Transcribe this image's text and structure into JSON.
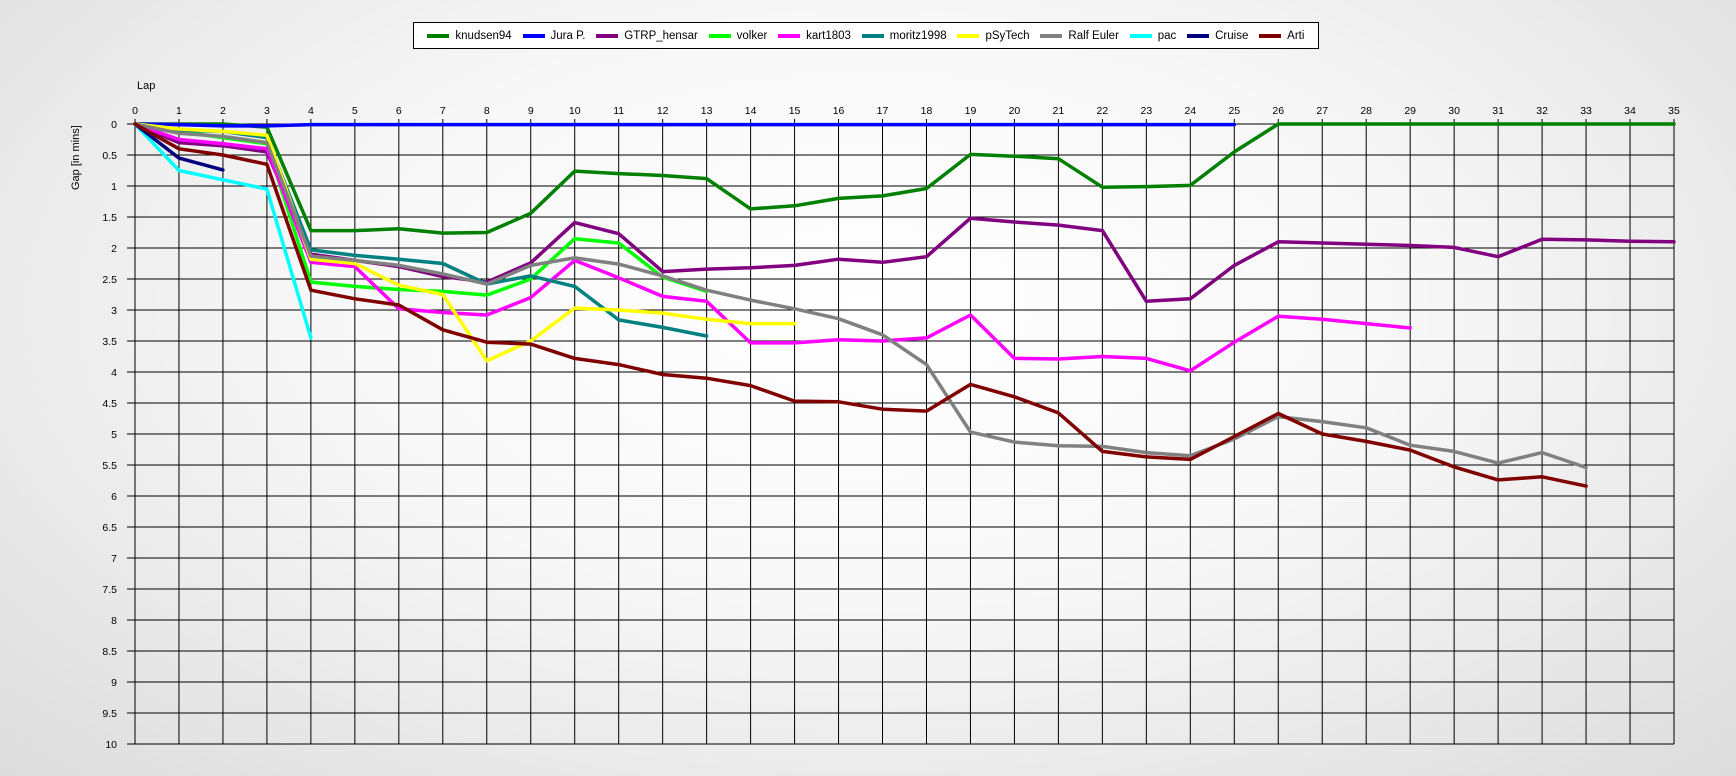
{
  "chart_data": {
    "type": "line",
    "xlabel": "Lap",
    "ylabel": "Gap [in mins]",
    "xlim": [
      0,
      35
    ],
    "ylim": [
      0,
      10
    ],
    "y_inverted": true,
    "grid": true,
    "legend_position": "top",
    "x_ticks": [
      "0",
      "1",
      "2",
      "3",
      "4",
      "5",
      "6",
      "7",
      "8",
      "9",
      "10",
      "11",
      "12",
      "13",
      "14",
      "15",
      "16",
      "17",
      "18",
      "19",
      "20",
      "21",
      "22",
      "23",
      "24",
      "25",
      "26",
      "27",
      "28",
      "29",
      "30",
      "31",
      "32",
      "33",
      "34",
      "35"
    ],
    "y_ticks": [
      "0",
      "0.5",
      "1",
      "1.5",
      "2",
      "2.5",
      "3",
      "3.5",
      "4",
      "4.5",
      "5",
      "5.5",
      "6",
      "6.5",
      "7",
      "7.5",
      "8",
      "8.5",
      "9",
      "9.5",
      "10"
    ],
    "series": [
      {
        "name": "knudsen94",
        "color": "#008000",
        "start_lap": 0,
        "values": [
          0,
          0,
          0,
          0.05,
          1.72,
          1.72,
          1.69,
          1.76,
          1.75,
          1.44,
          0.76,
          0.8,
          0.83,
          0.88,
          1.37,
          1.32,
          1.2,
          1.16,
          1.04,
          0.49,
          0.52,
          0.56,
          1.02,
          1.01,
          0.99,
          0.45,
          0,
          0,
          0,
          0,
          0,
          0,
          0,
          0,
          0,
          0
        ]
      },
      {
        "name": "Jura P.",
        "color": "#0000ff",
        "start_lap": 0,
        "values": [
          0,
          0.01,
          0.03,
          0.03,
          0.01,
          0.01,
          0.01,
          0.01,
          0.01,
          0.01,
          0.01,
          0.01,
          0.01,
          0.01,
          0.01,
          0.01,
          0.01,
          0.01,
          0.01,
          0.01,
          0.01,
          0.01,
          0.01,
          0.01,
          0.01,
          0.01
        ]
      },
      {
        "name": "GTRP_hensar",
        "color": "#800080",
        "start_lap": 0,
        "values": [
          0,
          0.3,
          0.35,
          0.45,
          2.1,
          2.2,
          2.3,
          2.46,
          2.55,
          2.24,
          1.59,
          1.77,
          2.38,
          2.34,
          2.32,
          2.28,
          2.18,
          2.23,
          2.14,
          1.52,
          1.58,
          1.63,
          1.72,
          2.86,
          2.82,
          2.28,
          1.9,
          1.92,
          1.94,
          1.96,
          1.99,
          2.14,
          1.86,
          1.87,
          1.89,
          1.9
        ]
      },
      {
        "name": "volker",
        "color": "#00ff00",
        "start_lap": 0,
        "values": [
          0,
          0.12,
          0.22,
          0.32,
          2.55,
          2.62,
          2.67,
          2.7,
          2.76,
          2.5,
          1.85,
          1.92,
          2.47,
          2.7
        ]
      },
      {
        "name": "kart1803",
        "color": "#ff00ff",
        "start_lap": 0,
        "values": [
          0,
          0.25,
          0.32,
          0.4,
          2.23,
          2.3,
          2.98,
          3.04,
          3.08,
          2.8,
          2.2,
          2.48,
          2.78,
          2.86,
          3.53,
          3.53,
          3.48,
          3.5,
          3.45,
          3.08,
          3.78,
          3.79,
          3.75,
          3.78,
          3.98,
          3.52,
          3.1,
          3.15,
          3.22,
          3.29
        ]
      },
      {
        "name": "moritz1998",
        "color": "#008080",
        "start_lap": 0,
        "values": [
          0,
          0.1,
          0.12,
          0.22,
          2.03,
          2.12,
          2.18,
          2.25,
          2.58,
          2.45,
          2.62,
          3.16,
          3.28,
          3.42
        ]
      },
      {
        "name": "pSyTech",
        "color": "#ffff00",
        "start_lap": 0,
        "values": [
          0,
          0.08,
          0.12,
          0.18,
          2.18,
          2.25,
          2.6,
          2.75,
          3.82,
          3.5,
          2.97,
          3.0,
          3.05,
          3.15,
          3.22,
          3.22
        ]
      },
      {
        "name": "Ralf Euler",
        "color": "#808080",
        "start_lap": 0,
        "values": [
          0,
          0.15,
          0.2,
          0.3,
          2.13,
          2.2,
          2.28,
          2.42,
          2.58,
          2.28,
          2.16,
          2.26,
          2.45,
          2.68,
          2.84,
          2.98,
          3.14,
          3.4,
          3.88,
          4.97,
          5.13,
          5.19,
          5.2,
          5.3,
          5.35,
          5.08,
          4.72,
          4.8,
          4.9,
          5.18,
          5.28,
          5.47,
          5.3,
          5.54
        ]
      },
      {
        "name": "pac",
        "color": "#00ffff",
        "start_lap": 0,
        "values": [
          0,
          0.75,
          0.9,
          1.05,
          3.45
        ]
      },
      {
        "name": "Cruise",
        "color": "#000080",
        "start_lap": 0,
        "values": [
          0,
          0.55,
          0.74
        ]
      },
      {
        "name": "Arti",
        "color": "#800000",
        "start_lap": 0,
        "values": [
          0,
          0.4,
          0.5,
          0.65,
          2.68,
          2.82,
          2.92,
          3.32,
          3.52,
          3.55,
          3.78,
          3.88,
          4.04,
          4.1,
          4.22,
          4.47,
          4.48,
          4.6,
          4.63,
          4.2,
          4.4,
          4.66,
          5.28,
          5.37,
          5.41,
          5.04,
          4.67,
          5.0,
          5.12,
          5.26,
          5.53,
          5.74,
          5.69,
          5.84
        ]
      }
    ]
  }
}
